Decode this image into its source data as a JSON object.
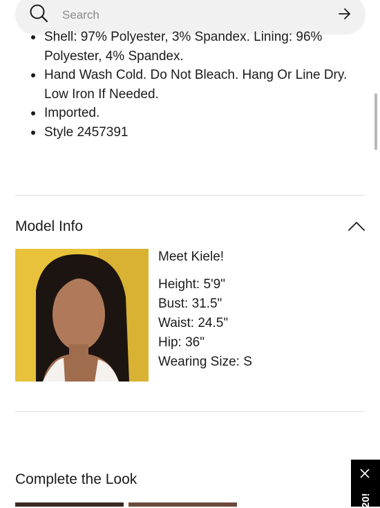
{
  "search": {
    "placeholder": "Search"
  },
  "details": {
    "items": [
      "Shell: 97% Polyester, 3% Spandex. Lining: 96% Polyester, 4% Spandex.",
      "Hand Wash Cold. Do Not Bleach. Hang Or Line Dry. Low Iron If Needed.",
      "Imported.",
      "Style 2457391"
    ]
  },
  "model_info": {
    "title": "Model Info",
    "meet": "Meet Kiele!",
    "height": "Height: 5'9\"",
    "bust": "Bust: 31.5\"",
    "waist": "Waist: 24.5\"",
    "hip": "Hip: 36\"",
    "size": "Wearing Size: S"
  },
  "complete_look": {
    "title": "Complete the Look"
  },
  "promo": {
    "text": "20!"
  },
  "colors": {
    "background": "#ffffff",
    "search_bg": "#f1f1f1",
    "promo_bg": "#000000",
    "photo_bg": "#e7c23a"
  },
  "icons": {
    "search": "search-icon",
    "submit": "arrow-right-icon",
    "collapse": "chevron-up-icon",
    "close": "close-icon"
  }
}
